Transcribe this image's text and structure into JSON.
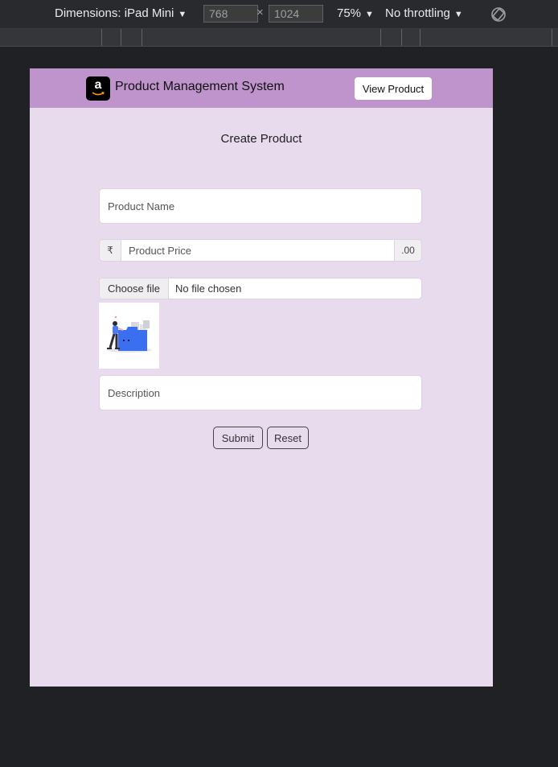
{
  "devtools": {
    "dimensions_label": "Dimensions: iPad Mini",
    "width_value": "768",
    "height_value": "1024",
    "times_symbol": "×",
    "zoom": "75%",
    "throttling": "No throttling",
    "caret": "▼",
    "rotate_icon": "rotate-icon"
  },
  "navbar": {
    "logo_icon": "amazon-logo-icon",
    "logo_letter": "a",
    "brand": "Product Management System",
    "view_button": "View Product",
    "background": "#bf94cc"
  },
  "page": {
    "title": "Create Product",
    "background": "#e9dbee"
  },
  "form": {
    "name_placeholder": "Product Name",
    "currency_symbol": "₹",
    "price_placeholder": "Product Price",
    "price_suffix": ".00",
    "file_button": "Choose file",
    "file_status": "No file chosen",
    "preview_icon": "folder-illustration-icon",
    "description_placeholder": "Description",
    "submit_label": "Submit",
    "reset_label": "Reset"
  }
}
